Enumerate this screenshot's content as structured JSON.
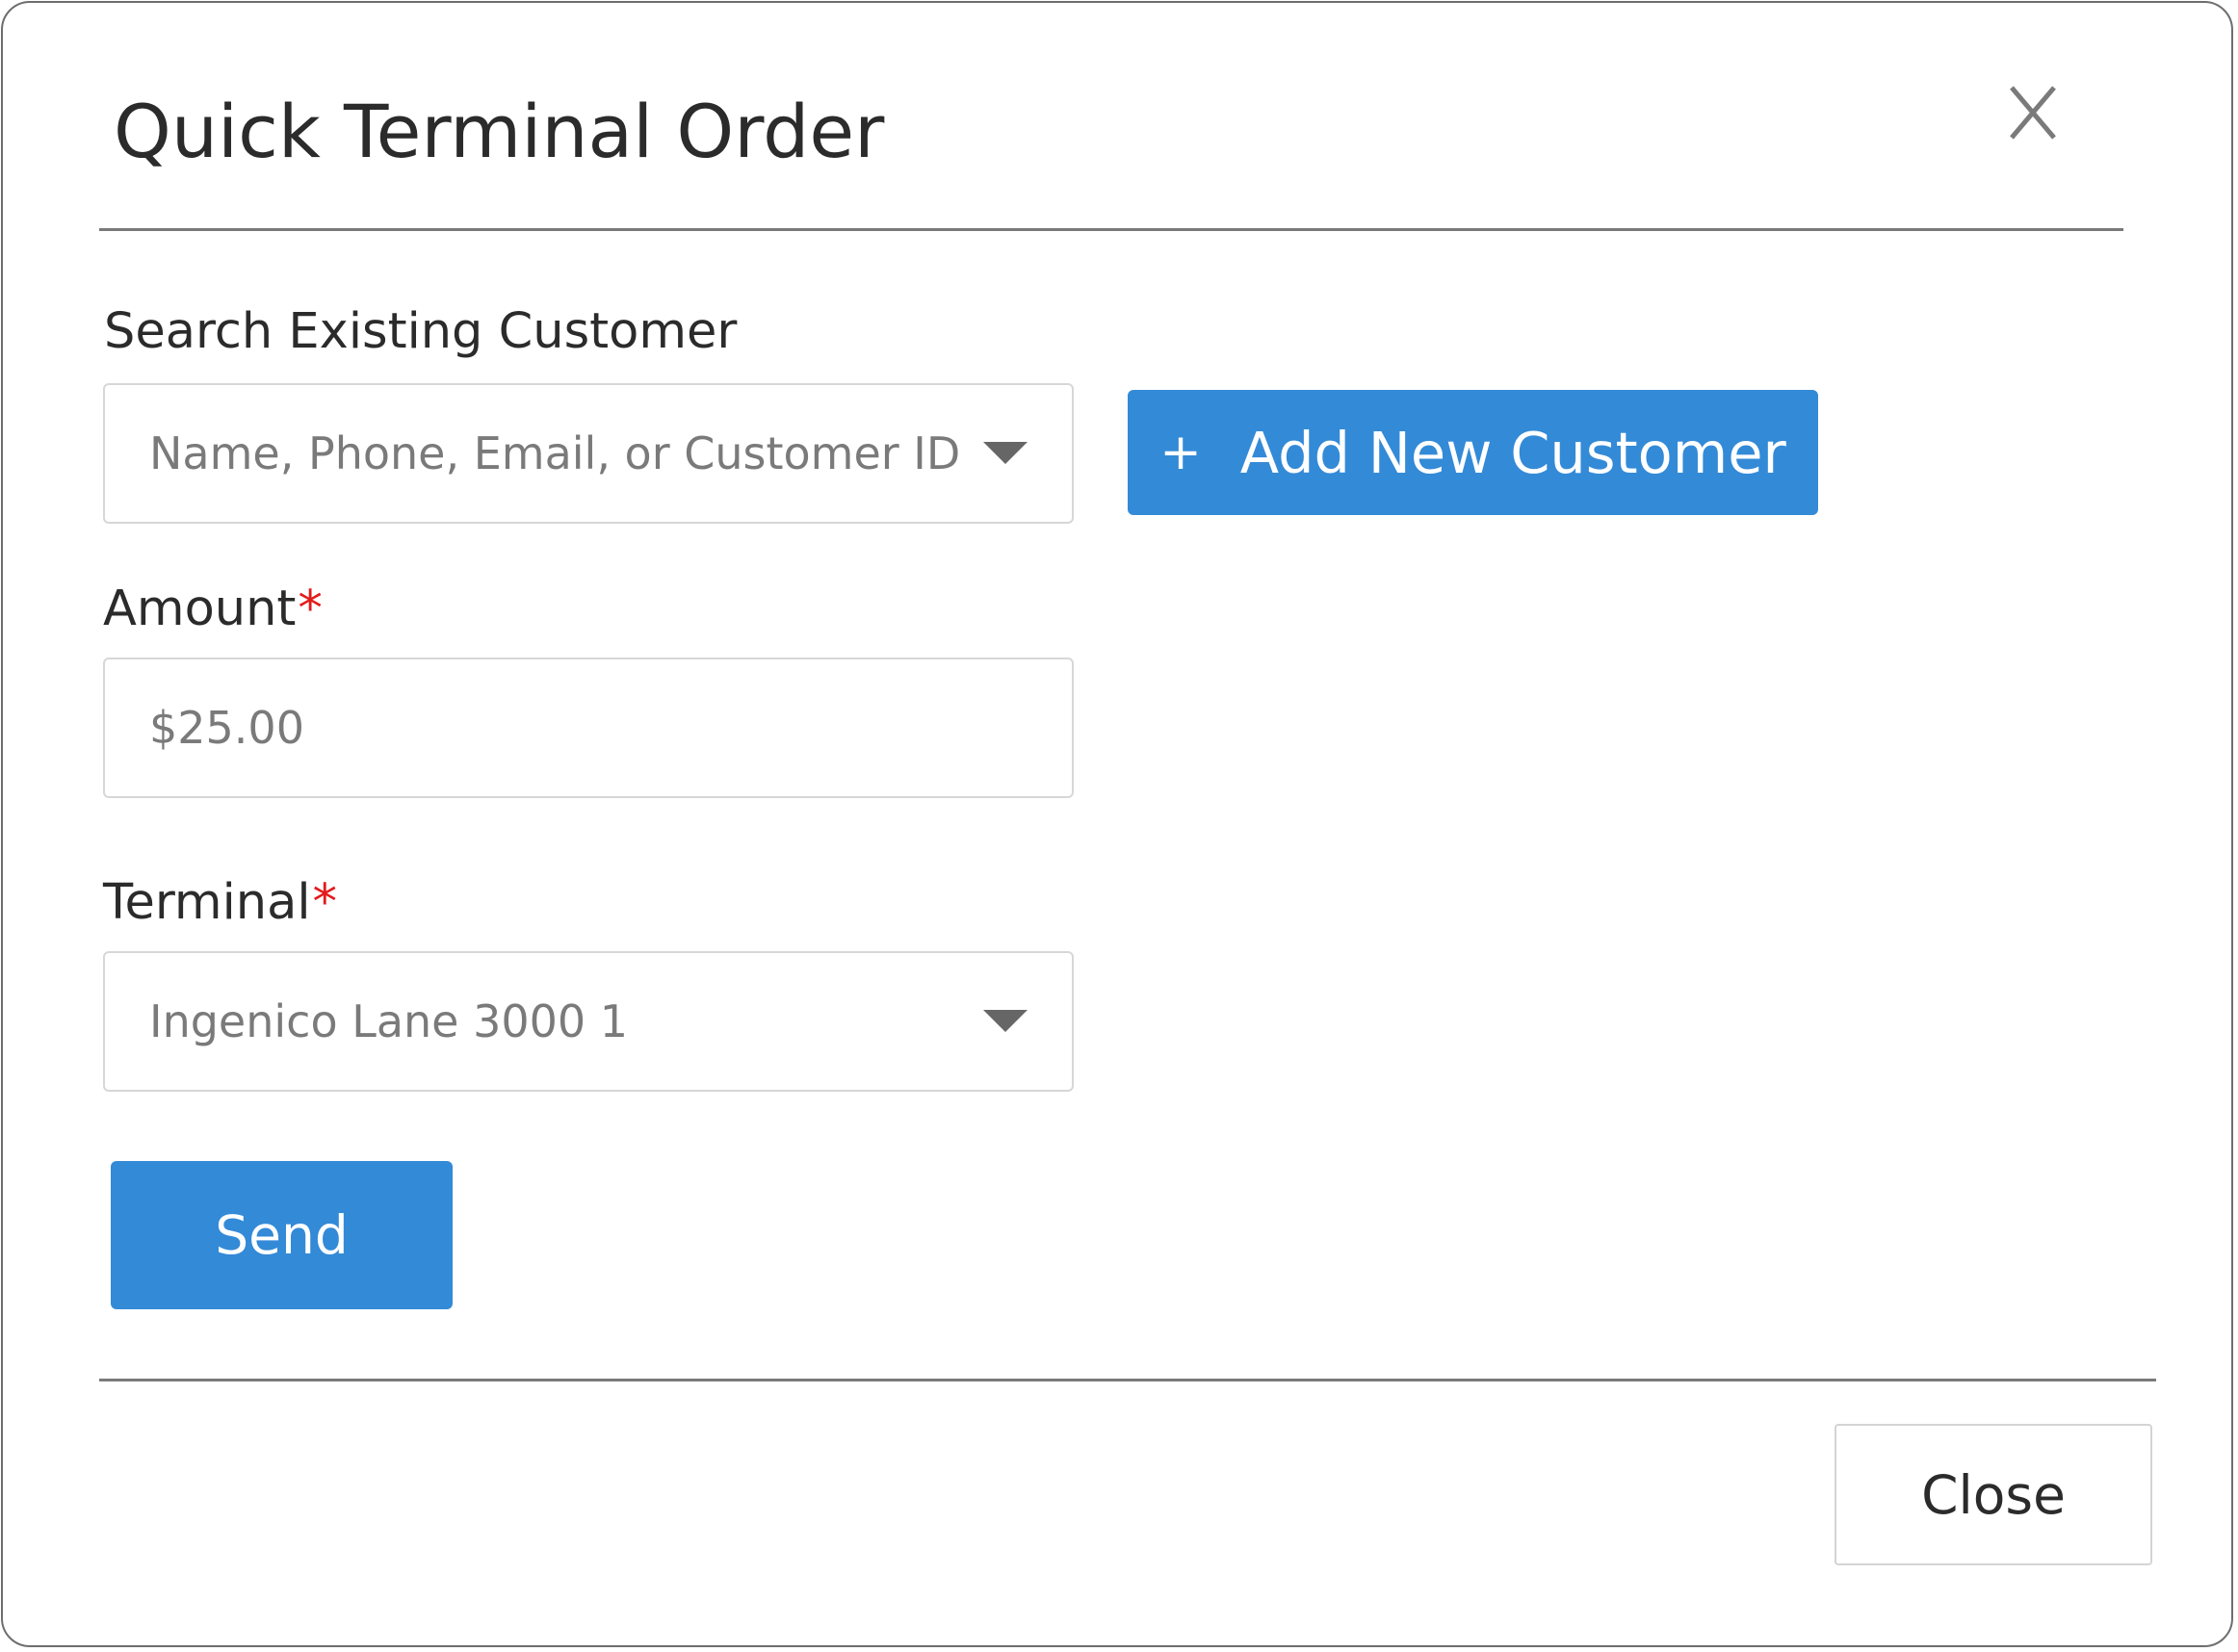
{
  "dialog": {
    "title": "Quick Terminal Order",
    "close_icon": "close-x-icon"
  },
  "customer": {
    "label": "Search Existing Customer",
    "placeholder": "Name, Phone, Email, or Customer ID",
    "add_button_icon": "+",
    "add_button_label": "Add New Customer"
  },
  "amount": {
    "label": "Amount",
    "required_marker": "*",
    "value": "$25.00"
  },
  "terminal": {
    "label": "Terminal",
    "required_marker": "*",
    "selected": "Ingenico Lane 3000 1"
  },
  "actions": {
    "send_label": "Send",
    "close_label": "Close"
  },
  "colors": {
    "primary": "#338ad7",
    "required": "#e31b1b",
    "text": "#2b2b2b",
    "placeholder": "#7a7a7a"
  }
}
